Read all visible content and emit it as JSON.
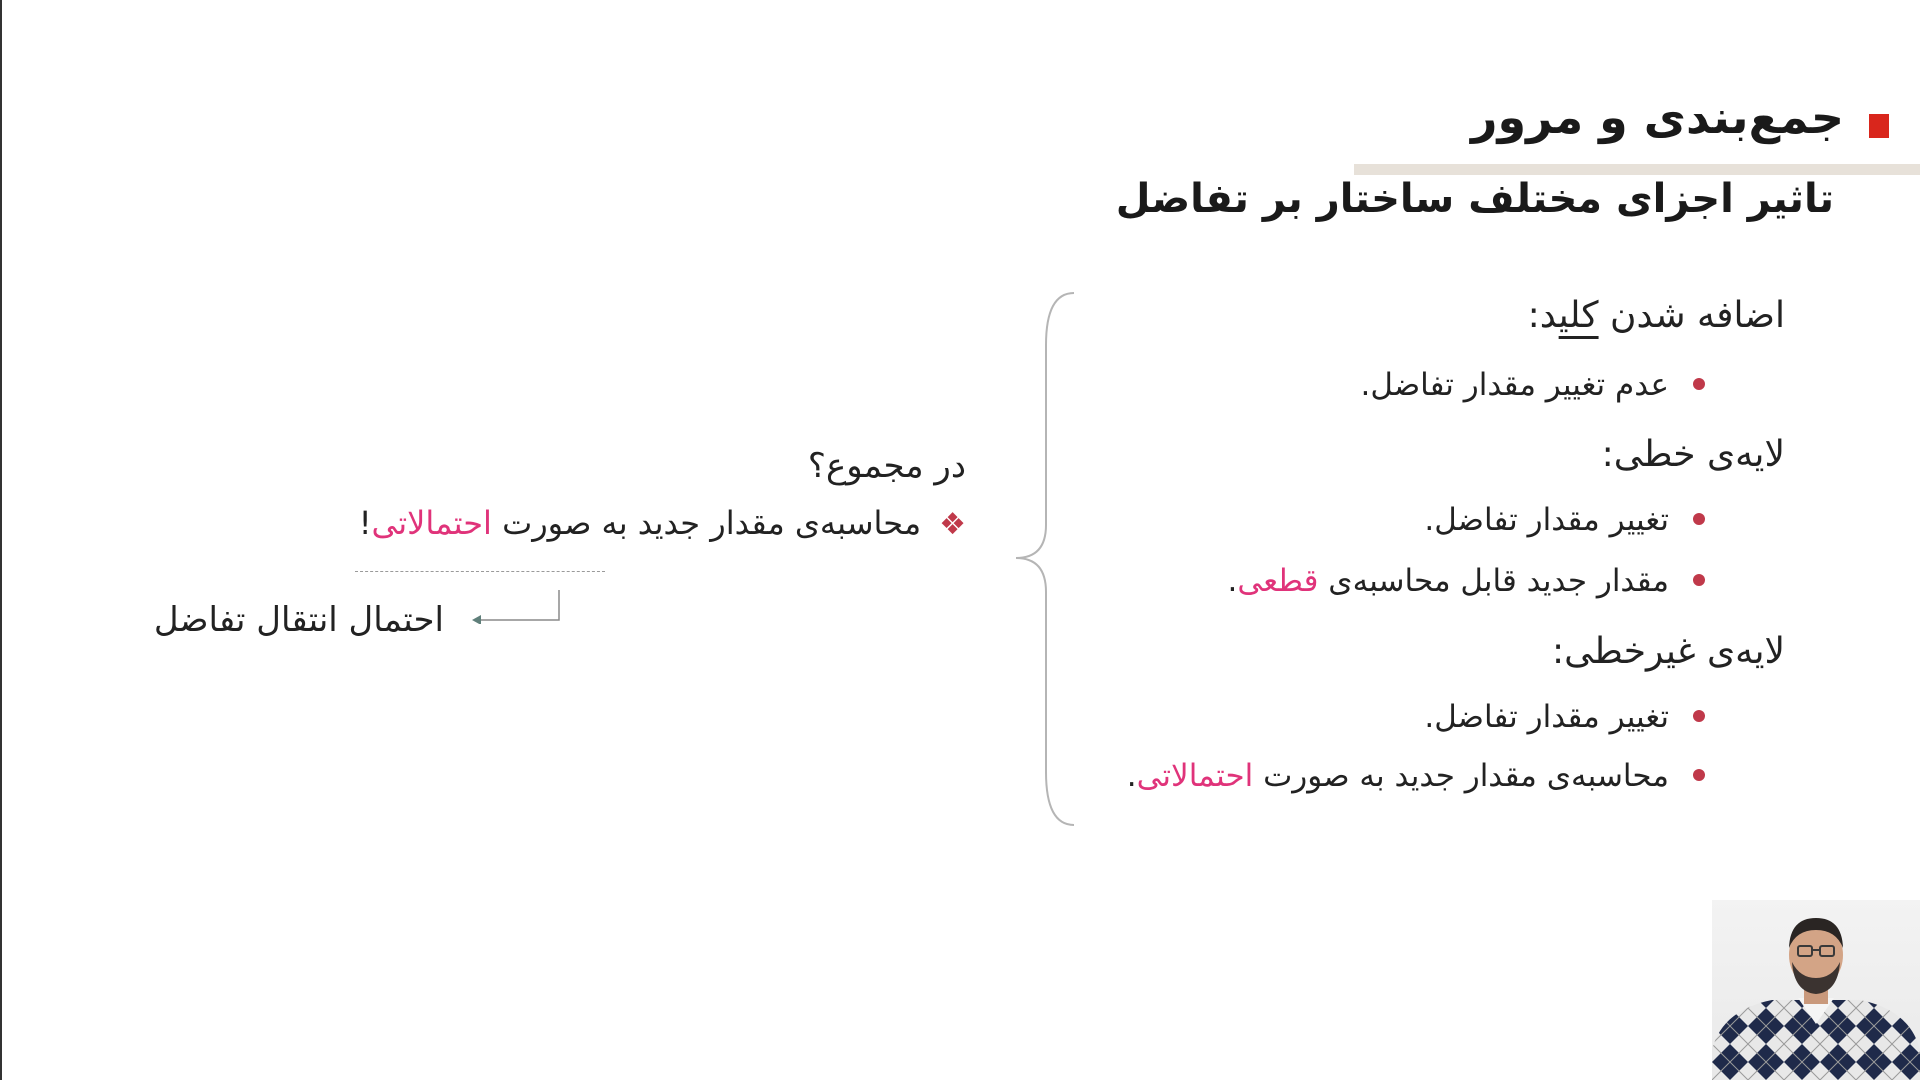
{
  "slide": {
    "title": "جمع‌بندی و مرور",
    "subtitle": "تاثیر اجزای مختلف ساختار بر تفاضل"
  },
  "sections": {
    "key_added": {
      "heading_before": "اضافه شدن ",
      "heading_underlined": "کلی",
      "heading_after": "د:",
      "bullet1": "عدم تغییر مقدار تفاضل."
    },
    "linear_layer": {
      "heading": "لایه‌ی خطی:",
      "bullet1": "تغییر مقدار تفاضل.",
      "bullet2_text": "مقدار جدید قابل محاسبه‌ی ",
      "bullet2_highlight": "قطعی",
      "bullet2_end": "."
    },
    "nonlinear_layer": {
      "heading": "لایه‌ی غیرخطی:",
      "bullet1": "تغییر مقدار تفاضل.",
      "bullet2_text": "محاسبه‌ی مقدار جدید به صورت ",
      "bullet2_highlight": "احتمالاتی",
      "bullet2_end": "."
    }
  },
  "summary": {
    "question": "در مجموع؟",
    "diamond_glyph": "❖",
    "point_text": "محاسبه‌ی مقدار جدید به صورت ",
    "point_highlight": "احتمالاتی",
    "point_end": "!",
    "arrow_target": "احتمال انتقال تفاضل"
  },
  "colors": {
    "title_marker": "#d9261c",
    "highlight": "#e0337a",
    "bullet": "#c0394a",
    "title_rule": "#e7e1d9"
  }
}
